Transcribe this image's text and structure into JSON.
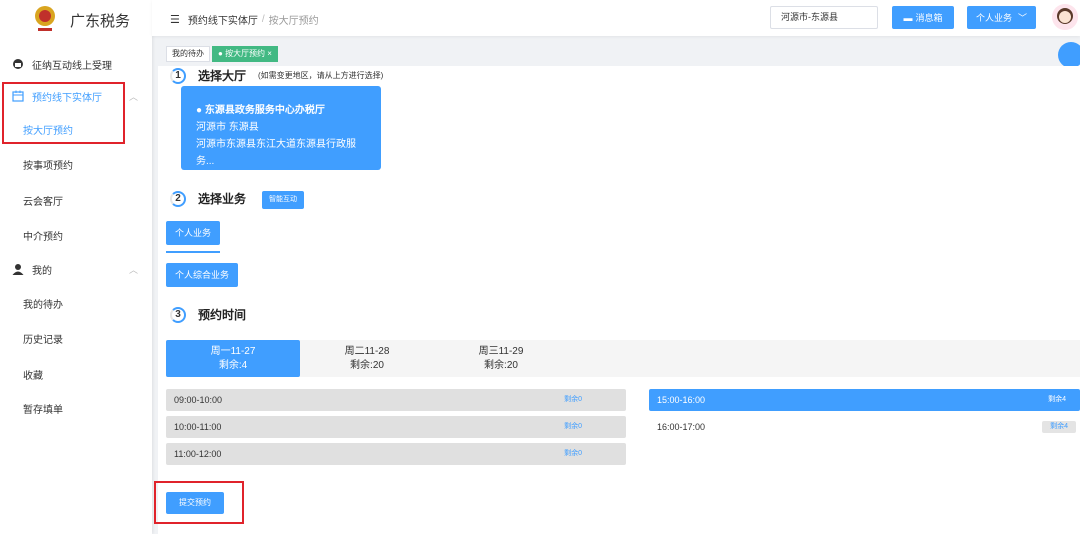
{
  "app": {
    "title": "广东税务"
  },
  "sidebar": {
    "menus": [
      {
        "label": "征纳互动线上受理",
        "icon": "headset-icon"
      },
      {
        "label": "预约线下实体厅",
        "icon": "calendar-icon",
        "sub": [
          "按大厅预约",
          "按事项预约",
          "云会客厅",
          "中介预约"
        ]
      },
      {
        "label": "我的",
        "icon": "user-icon",
        "sub": [
          "我的待办",
          "历史记录",
          "收藏",
          "暂存填单"
        ]
      }
    ]
  },
  "header": {
    "breadcrumb": [
      "预约线下实体厅",
      "按大厅预约"
    ],
    "region": "河源市-东源县",
    "message_label": "消息箱",
    "biz_label": "个人业务"
  },
  "tags": [
    "我的待办",
    "按大厅预约"
  ],
  "steps": [
    {
      "num": "1",
      "title": "选择大厅",
      "hint": "(如需变更地区，请从上方进行选择)"
    },
    {
      "num": "2",
      "title": "选择业务",
      "button": "智能互动"
    },
    {
      "num": "3",
      "title": "预约时间"
    }
  ],
  "hall": {
    "name": "● 东源县政务服务中心办税厅",
    "city": "河源市 东源县",
    "address": "河源市东源县东江大道东源县行政服务..."
  },
  "business": [
    "个人业务",
    "个人综合业务"
  ],
  "days": [
    {
      "date": "周一11-27",
      "remain": "剩余:4"
    },
    {
      "date": "周二11-28",
      "remain": "剩余:20"
    },
    {
      "date": "周三11-29",
      "remain": "剩余:20"
    }
  ],
  "slots_left": [
    {
      "time": "09:00-10:00",
      "remain": "剩余0"
    },
    {
      "time": "10:00-11:00",
      "remain": "剩余0"
    },
    {
      "time": "11:00-12:00",
      "remain": "剩余0"
    }
  ],
  "slots_right": [
    {
      "time": "15:00-16:00",
      "remain": "剩余4"
    },
    {
      "time": "16:00-17:00",
      "remain": "剩余4"
    }
  ],
  "submit_label": "提交预约",
  "colors": {
    "primary": "#409eff",
    "tag_active": "#42b983",
    "highlight_box": "#e0232b"
  }
}
